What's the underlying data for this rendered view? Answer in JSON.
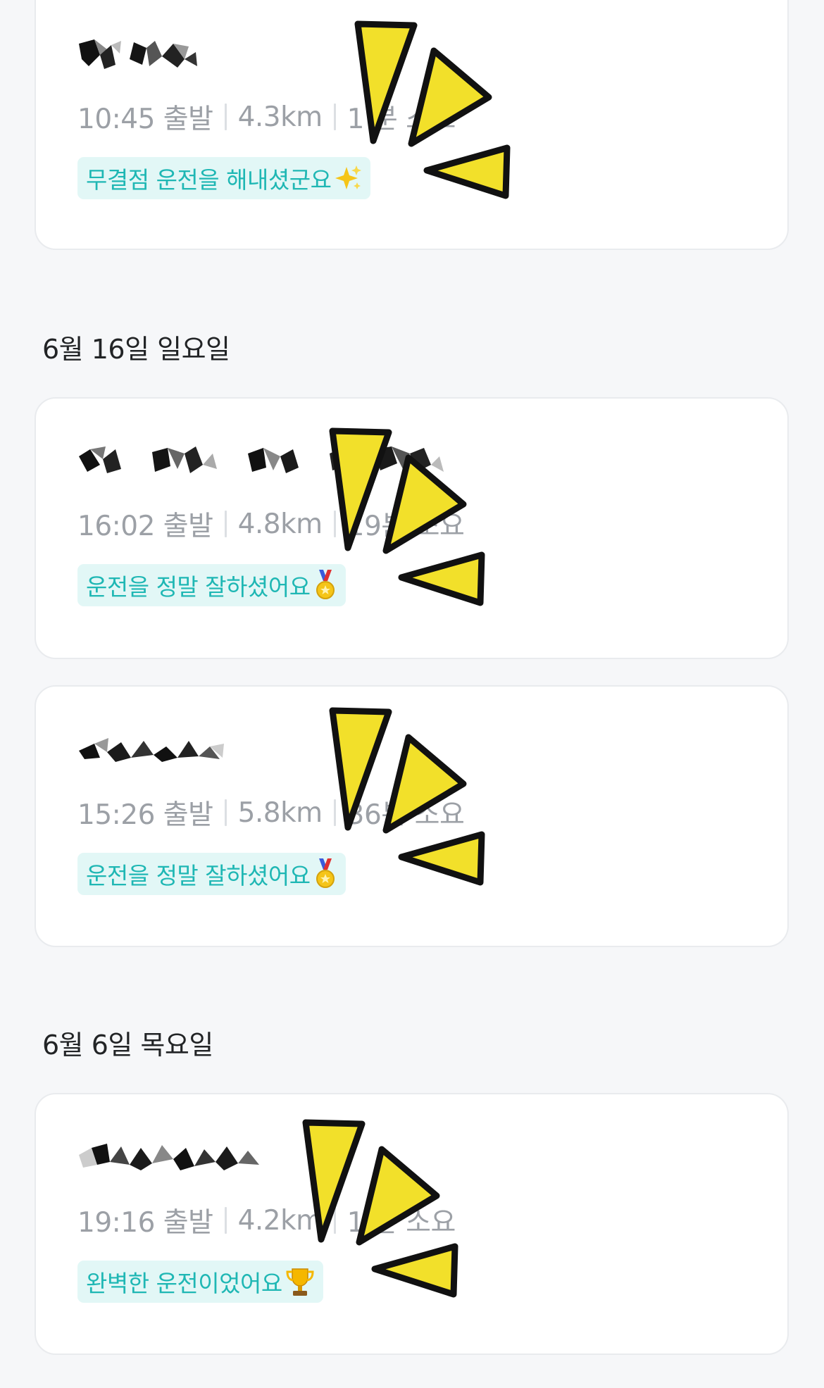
{
  "sections": [
    {
      "date": "",
      "trips": [
        {
          "title_icon": "redacted-name-icon",
          "depart": "10:45 출발",
          "distance": "4.3km",
          "duration": "1 분 소요",
          "badge": "무결점 운전을 해내셨군요",
          "badge_icon": "sparkles-icon"
        }
      ]
    },
    {
      "date": "6월 16일 일요일",
      "trips": [
        {
          "title_icon": "redacted-name-icon",
          "depart": "16:02 출발",
          "distance": "4.8km",
          "duration": "19분 소요",
          "badge": "운전을 정말 잘하셨어요",
          "badge_icon": "medal-icon"
        },
        {
          "title_icon": "redacted-name-icon",
          "depart": "15:26 출발",
          "distance": "5.8km",
          "duration": "36분 소요",
          "badge": "운전을 정말 잘하셨어요",
          "badge_icon": "medal-icon"
        }
      ]
    },
    {
      "date": "6월 6일 목요일",
      "trips": [
        {
          "title_icon": "redacted-name-icon",
          "depart": "19:16 출발",
          "distance": "4.2km",
          "duration": "1 분 소요",
          "badge": "완벽한 운전이었어요",
          "badge_icon": "trophy-icon"
        }
      ]
    }
  ],
  "colors": {
    "background": "#f6f7f9",
    "card": "#ffffff",
    "badge_bg": "#e2f7f6",
    "badge_text": "#1fb7b4",
    "meta_text": "#9ca0a6",
    "sparkle": "#f2e02a"
  }
}
